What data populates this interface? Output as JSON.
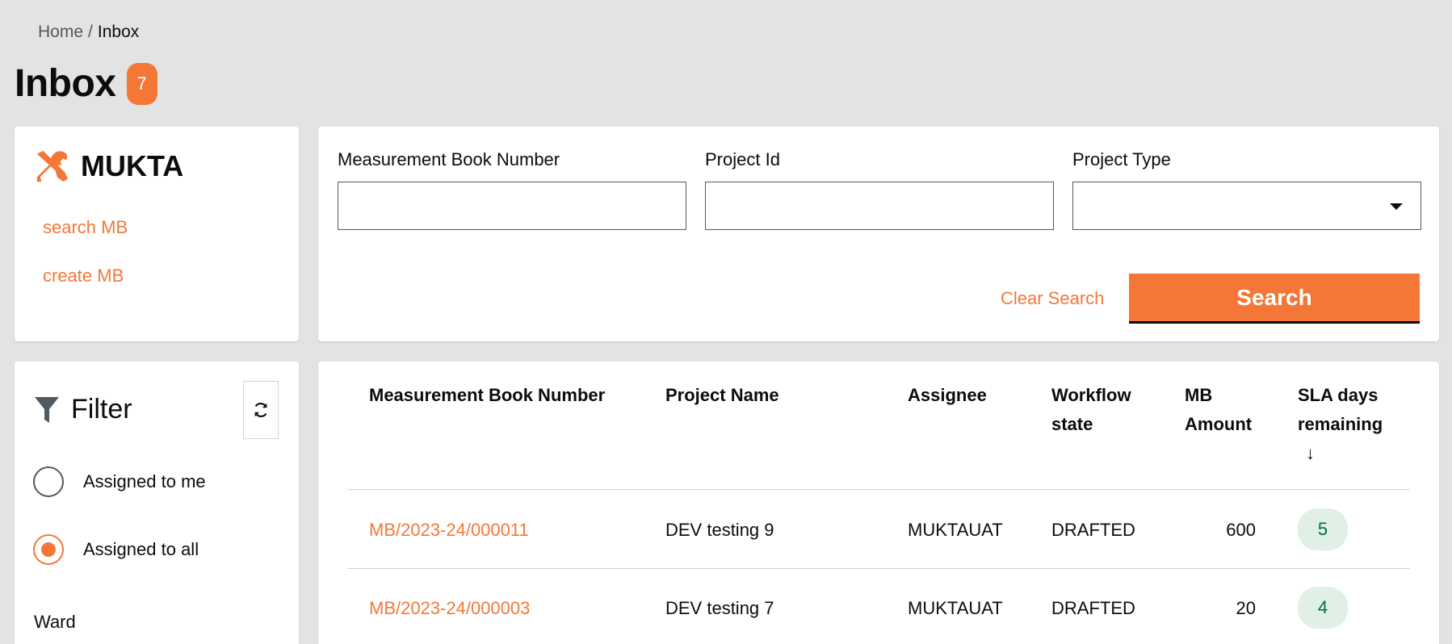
{
  "breadcrumb": {
    "home": "Home",
    "separator": "/",
    "current": "Inbox"
  },
  "header": {
    "title": "Inbox",
    "count": "7"
  },
  "module": {
    "name": "MUKTA",
    "icon": "hammer-wrench-icon",
    "links": [
      {
        "label": "search MB"
      },
      {
        "label": "create MB"
      }
    ]
  },
  "search": {
    "fields": [
      {
        "label": "Measurement Book Number",
        "value": ""
      },
      {
        "label": "Project Id",
        "value": ""
      },
      {
        "label": "Project Type",
        "value": ""
      }
    ],
    "clear_label": "Clear Search",
    "search_label": "Search"
  },
  "filter": {
    "title": "Filter",
    "options": [
      {
        "label": "Assigned to me",
        "checked": false
      },
      {
        "label": "Assigned to all",
        "checked": true
      }
    ],
    "ward_label": "Ward"
  },
  "table": {
    "columns": [
      {
        "line1": "Measurement Book Number",
        "line2": ""
      },
      {
        "line1": "Project Name",
        "line2": ""
      },
      {
        "line1": "Assignee",
        "line2": ""
      },
      {
        "line1": "Workflow",
        "line2": "state"
      },
      {
        "line1": "MB",
        "line2": "Amount"
      },
      {
        "line1": "SLA days",
        "line2": "remaining",
        "sort": "↓"
      }
    ],
    "rows": [
      {
        "mb_number": "MB/2023-24/000011",
        "project_name": "DEV testing 9",
        "assignee": "MUKTAUAT",
        "state": "DRAFTED",
        "amount": "600",
        "sla": "5"
      },
      {
        "mb_number": "MB/2023-24/000003",
        "project_name": "DEV testing 7",
        "assignee": "MUKTAUAT",
        "state": "DRAFTED",
        "amount": "20",
        "sla": "4"
      }
    ]
  },
  "colors": {
    "accent": "#f47738",
    "background": "#e3e3e3",
    "sla_bg": "#e0f0e6",
    "sla_text": "#00703c"
  }
}
